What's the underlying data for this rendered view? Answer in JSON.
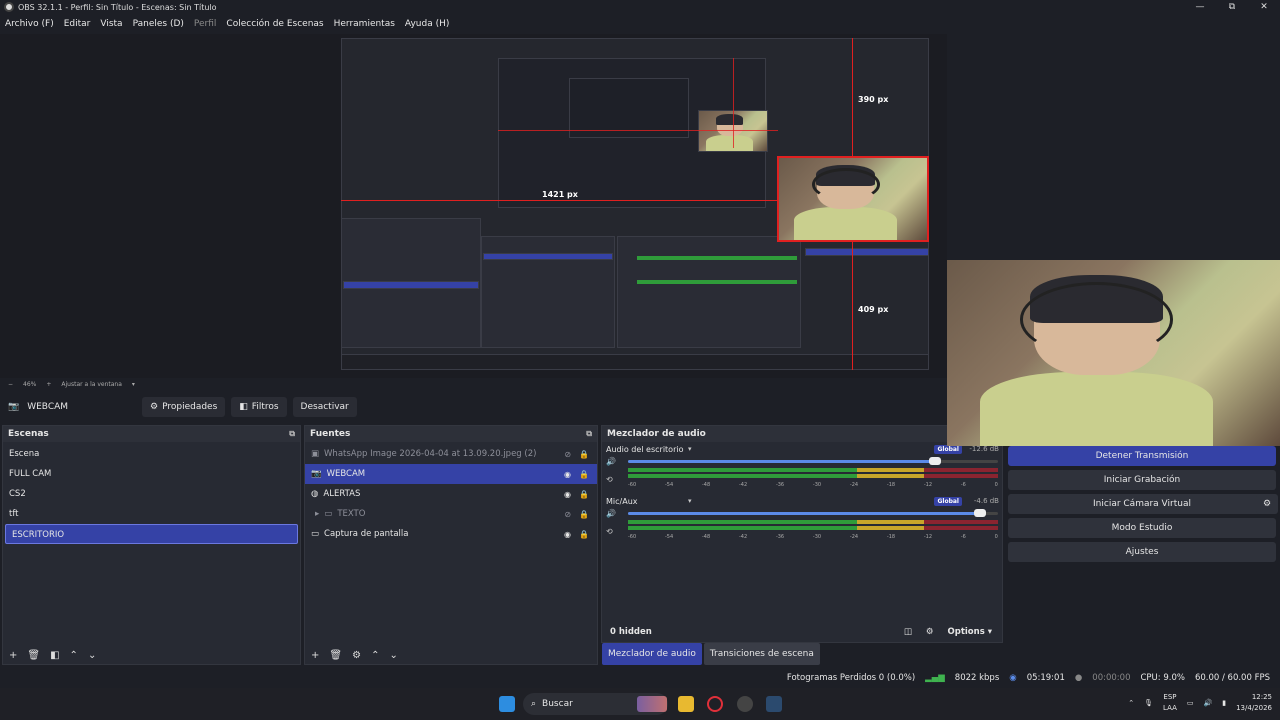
{
  "window": {
    "title": "OBS 32.1.1 - Perfil: Sin Título - Escenas: Sin Título",
    "controls": [
      "—",
      "⧉",
      "✕"
    ]
  },
  "menu": [
    {
      "label": "Archivo (F)"
    },
    {
      "label": "Editar"
    },
    {
      "label": "Vista"
    },
    {
      "label": "Paneles (D)"
    },
    {
      "label": "Perfil"
    },
    {
      "label": "Colección de Escenas"
    },
    {
      "label": "Herramientas"
    },
    {
      "label": "Ayuda (H)"
    }
  ],
  "preview": {
    "measure_top": "390 px",
    "measure_left": "1421 px",
    "measure_bottom": "409 px"
  },
  "zoom": {
    "minus": "−",
    "level": "46%",
    "plus": "+",
    "fit": "Ajustar a la ventana"
  },
  "source_toolbar": {
    "selected_source": "WEBCAM",
    "properties": "Propiedades",
    "filters": "Filtros",
    "deactivate": "Desactivar"
  },
  "scenes": {
    "title": "Escenas",
    "items": [
      "Escena",
      "FULL CAM",
      "CS2",
      "tft",
      "ESCRITORIO"
    ],
    "selected": "ESCRITORIO"
  },
  "sources": {
    "title": "Fuentes",
    "items": [
      {
        "label": "WhatsApp Image 2026-04-04 at 13.09.20.jpeg (2)",
        "state": "hidden"
      },
      {
        "label": "WEBCAM",
        "state": "selected"
      },
      {
        "label": "ALERTAS",
        "state": "visible"
      },
      {
        "label": "TEXTO",
        "state": "hidden-group"
      },
      {
        "label": "Captura de pantalla",
        "state": "visible"
      }
    ]
  },
  "mixer": {
    "title": "Mezclador de audio",
    "channels": [
      {
        "name": "Audio del escritorio",
        "badge": "Global",
        "db": "-12.6 dB",
        "volume": 0.83
      },
      {
        "name": "Mic/Aux",
        "badge": "Global",
        "db": "-4.6 dB",
        "volume": 0.95
      }
    ],
    "ticks": [
      "-60",
      "-54",
      "-48",
      "-42",
      "-36",
      "-30",
      "-24",
      "-18",
      "-12",
      "-6",
      "0"
    ],
    "hidden": "0 hidden",
    "options": "Options"
  },
  "bottom_tabs": {
    "mixer": "Mezclador de audio",
    "transitions": "Transiciones de escena"
  },
  "controls": {
    "stop_stream": "Detener Transmisión",
    "start_record": "Iniciar Grabación",
    "start_vcam": "Iniciar Cámara Virtual",
    "studio": "Modo Estudio",
    "settings": "Ajustes"
  },
  "status": {
    "dropped": "Fotogramas Perdidos 0 (0.0%)",
    "bitrate": "8022 kbps",
    "live_time": "05:19:01",
    "rec_time": "00:00:00",
    "cpu": "CPU: 9.0%",
    "fps": "60.00 / 60.00 FPS"
  },
  "taskbar": {
    "search": "Buscar",
    "lang": "ESP",
    "region": "LAA",
    "time": "12:25",
    "date": "13/4/2026"
  }
}
